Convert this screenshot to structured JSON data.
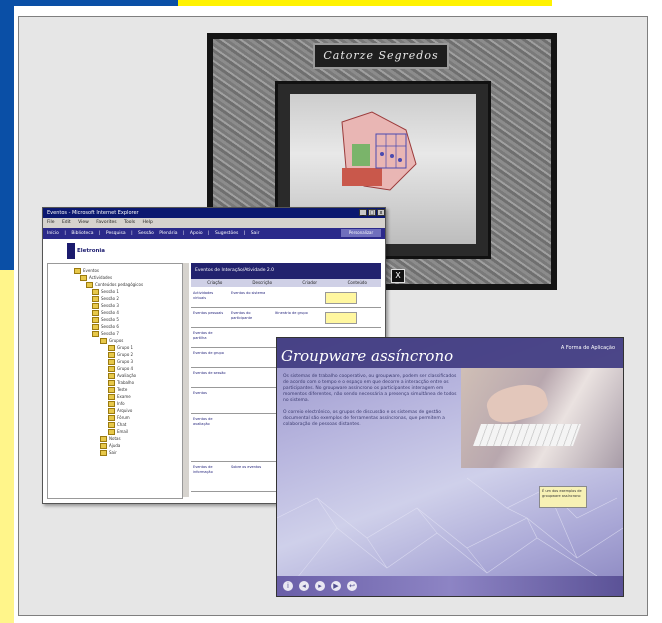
{
  "stone_window": {
    "title": "Catorze Segredos",
    "corner_button": "X"
  },
  "browser_window": {
    "title_bar": "Eventos - Microsoft Internet Explorer",
    "controls": [
      "_",
      "□",
      "x"
    ],
    "menu": [
      "File",
      "Edit",
      "View",
      "Favorites",
      "Tools",
      "Help"
    ],
    "nav_links": [
      "Início",
      "Biblioteca",
      "Pesquisa",
      "Sessão Plenária",
      "Apoio",
      "Sugestões",
      "Sair"
    ],
    "nav_right": "Personalizar",
    "header_label": "Eletronia",
    "table": {
      "header": "Eventos de Interação/Atividade 2.0",
      "columns": [
        "Criação",
        "Descrição",
        "Criador",
        "Conteúdo"
      ],
      "rows": [
        {
          "c1": "Actividades virtuais",
          "c2": "Eventos do sistema",
          "c3": "",
          "has_badge": true
        },
        {
          "c1": "Eventos pessoais",
          "c2": "Eventos do participante",
          "c3": "Itinerário de grupo",
          "has_badge": true
        },
        {
          "c1": "Eventos de partilha",
          "c2": "",
          "c3": "",
          "has_badge": false
        },
        {
          "c1": "Eventos de grupo",
          "c2": "",
          "c3": "",
          "has_badge": false
        },
        {
          "c1": "Eventos de sessão",
          "c2": "",
          "c3": "",
          "has_badge": false
        },
        {
          "c1": "Eventos",
          "c2": "",
          "c3": "",
          "has_badge": false
        },
        {
          "c1": "Eventos de avaliação",
          "c2": "",
          "c3": "",
          "has_badge": false
        },
        {
          "c1": "Eventos de informação",
          "c2": "Sobre os eventos",
          "c3": "",
          "has_badge": false
        }
      ]
    },
    "tree_items": [
      "Eventos",
      "Actividades",
      "Conteúdos pedagógicos",
      "Sessão 1",
      "Sessão 2",
      "Sessão 3",
      "Sessão 4",
      "Sessão 5",
      "Sessão 6",
      "Sessão 7",
      "Grupos",
      "Grupo 1",
      "Grupo 2",
      "Grupo 3",
      "Grupo 4",
      "Avaliação",
      "Trabalho",
      "Teste",
      "Exame",
      "Info",
      "Arquivo",
      "Fórum",
      "Chat",
      "Email",
      "Notas",
      "Ajuda",
      "Sair"
    ]
  },
  "groupware_window": {
    "title": "Groupware assíncrono",
    "subtitle": "A Forma de Aplicação",
    "paragraph1": "Os sistemas de trabalho cooperativo, ou groupware, podem ser classificados de acordo com o tempo e o espaço em que decorre a interacção entre os participantes. No groupware assíncrono os participantes interagem em momentos diferentes, não sendo necessária a presença simultânea de todos no sistema.",
    "paragraph2": "O correio electrónico, os grupos de discussão e os sistemas de gestão documental são exemplos de ferramentas assíncronas, que permitem a colaboração de pessoas distantes.",
    "note": "É um dos exemplos de groupware assíncrono",
    "controls": [
      "i",
      "◂",
      "▸",
      "▶",
      "↩"
    ]
  }
}
